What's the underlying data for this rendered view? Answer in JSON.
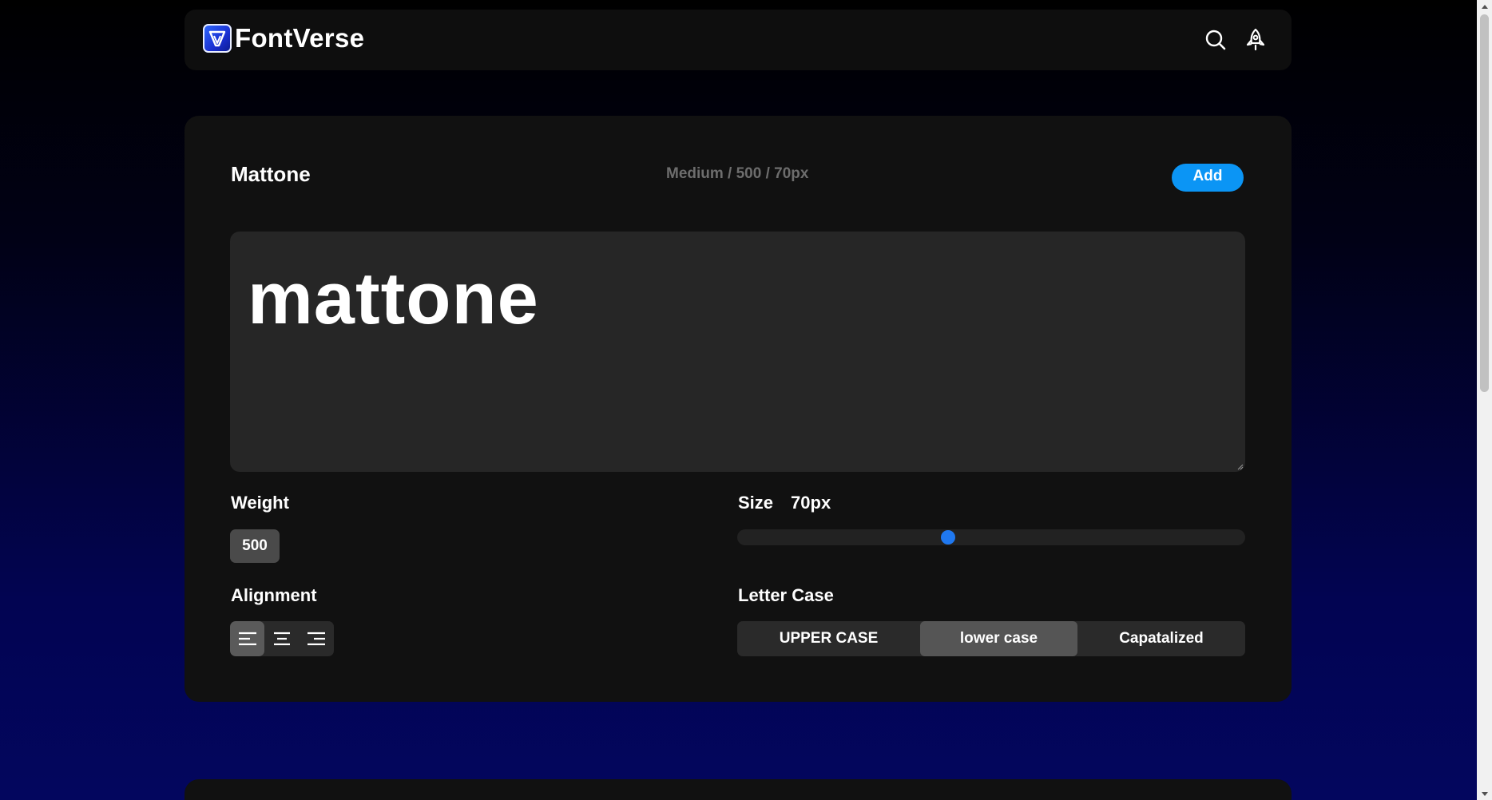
{
  "app": {
    "name": "FontVerse"
  },
  "header": {
    "icons": [
      "search-icon",
      "rocket-icon"
    ]
  },
  "font_card": {
    "font_name": "Mattone",
    "meta": "Medium / 500 / 70px",
    "add_label": "Add",
    "preview_text": "mattone",
    "weight": {
      "label": "Weight",
      "value": "500"
    },
    "size": {
      "label": "Size",
      "value_text": "70px",
      "slider_fraction": 0.415
    },
    "alignment": {
      "label": "Alignment",
      "options": [
        "align-left-icon",
        "align-center-icon",
        "align-right-icon"
      ],
      "selected": "left"
    },
    "letter_case": {
      "label": "Letter Case",
      "options": [
        "UPPER CASE",
        "lower case",
        "Capatalized"
      ],
      "selected": "lower case"
    }
  },
  "colors": {
    "accent": "#0b95f5",
    "slider_thumb": "#1f78f0",
    "card_bg": "#111111",
    "preview_bg": "#262626"
  }
}
